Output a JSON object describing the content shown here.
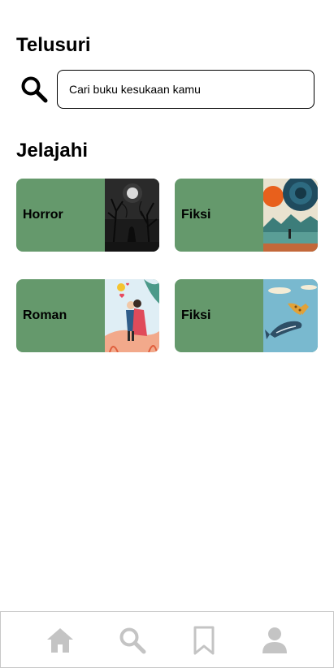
{
  "header": {
    "title": "Telusuri"
  },
  "search": {
    "placeholder": "Cari buku kesukaan kamu",
    "icon": "search-icon"
  },
  "explore": {
    "title": "Jelajahi",
    "categories": [
      {
        "label": "Horror",
        "cover": "dark-forest-cover"
      },
      {
        "label": "Fiksi",
        "cover": "surreal-landscape-cover"
      },
      {
        "label": "Roman",
        "cover": "couple-romance-cover"
      },
      {
        "label": "Fiksi",
        "cover": "whale-sky-cover"
      }
    ]
  },
  "nav": {
    "items": [
      {
        "name": "home",
        "icon": "home-icon"
      },
      {
        "name": "search",
        "icon": "search-icon"
      },
      {
        "name": "bookmark",
        "icon": "bookmark-icon"
      },
      {
        "name": "profile",
        "icon": "user-icon"
      }
    ]
  },
  "colors": {
    "card": "#65996c",
    "nav_icon": "#c4c4c4",
    "text": "#000000"
  }
}
